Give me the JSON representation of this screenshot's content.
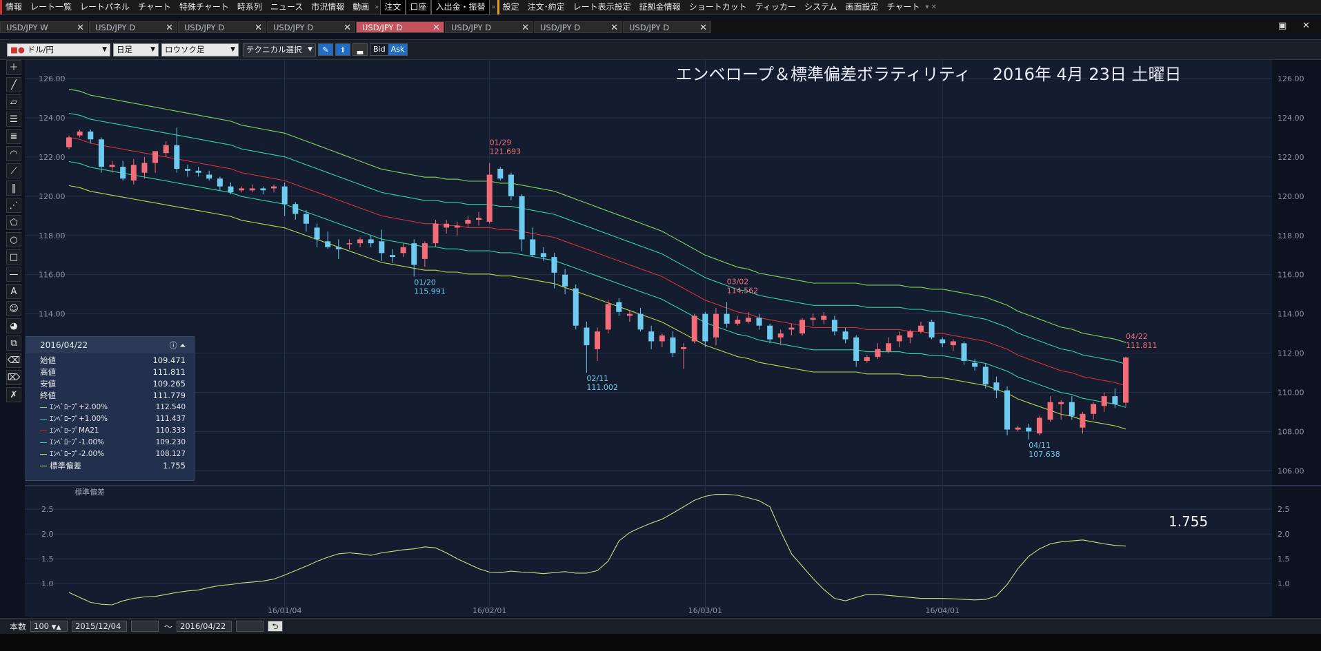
{
  "menu": [
    "情報",
    "レート一覧",
    "レートパネル",
    "チャート",
    "特殊チャート",
    "時系列",
    "ニュース",
    "市況情報",
    "動画",
    "注文",
    "口座",
    "入出金・振替",
    "設定",
    "注文･約定",
    "レート表示設定",
    "証拠金情報",
    "ショートカット",
    "ティッカー",
    "システム",
    "画面設定",
    "チャート"
  ],
  "tabs": [
    "USD/JPY W",
    "USD/JPY D",
    "USD/JPY D",
    "USD/JPY D",
    "USD/JPY D",
    "USD/JPY D",
    "USD/JPY D",
    "USD/JPY D"
  ],
  "active_tab": 4,
  "toolbar": {
    "pair": "ドル/円",
    "period": "日足",
    "style": "ロウソク足",
    "technical": "テクニカル選択",
    "bid": "Bid",
    "ask": "Ask"
  },
  "chart_title": "エンベロープ＆標準偏差ボラティリティ　 2016年 4月 23日 土曜日",
  "colors": {
    "bg": "#141c30",
    "up": "#f26d77",
    "down": "#6dcbf0",
    "env_outer": "#7ed957",
    "env_inner": "#2bd6a4",
    "ma": "#d5302f",
    "lower_outer": "#b9d84a",
    "stddev": "#c8e07a"
  },
  "info": {
    "date": "2016/04/22",
    "rows": [
      {
        "label": "始値",
        "value": "109.471",
        "color": ""
      },
      {
        "label": "高値",
        "value": "111.811",
        "color": ""
      },
      {
        "label": "安値",
        "value": "109.265",
        "color": ""
      },
      {
        "label": "終値",
        "value": "111.779",
        "color": ""
      },
      {
        "label": "ｴﾝﾍﾞﾛｰﾌﾟ+2.00%",
        "value": "112.540",
        "color": "#7ed957"
      },
      {
        "label": "ｴﾝﾍﾞﾛｰﾌﾟ+1.00%",
        "value": "111.437",
        "color": "#2bd6a4"
      },
      {
        "label": "ｴﾝﾍﾞﾛｰﾌﾟMA21",
        "value": "110.333",
        "color": "#d5302f"
      },
      {
        "label": "ｴﾝﾍﾞﾛｰﾌﾟ-1.00%",
        "value": "109.230",
        "color": "#2bd6a4"
      },
      {
        "label": "ｴﾝﾍﾞﾛｰﾌﾟ-2.00%",
        "value": "108.127",
        "color": "#b9d84a"
      },
      {
        "label": "標準偏差",
        "value": "1.755",
        "color": "#c8e07a"
      }
    ]
  },
  "bottom": {
    "count_label": "本数",
    "count": "100",
    "from": "2015/12/04",
    "tilde": "～",
    "to": "2016/04/22"
  },
  "chart_data": {
    "type": "candlestick",
    "price_axis": {
      "ticks": [
        "106.00",
        "108.00",
        "110.00",
        "112.00",
        "114.00",
        "116.00",
        "118.00",
        "120.00",
        "122.00",
        "124.00",
        "126.00"
      ],
      "ylim": [
        105.8,
        126.6
      ]
    },
    "x_labels": [
      {
        "i": 20,
        "label": "16/01/04"
      },
      {
        "i": 39,
        "label": "16/02/01"
      },
      {
        "i": 59,
        "label": "16/03/01"
      },
      {
        "i": 81,
        "label": "16/04/01"
      }
    ],
    "candles": [
      [
        122.5,
        123.1,
        122.4,
        123.0
      ],
      [
        123.1,
        123.4,
        123.0,
        123.3
      ],
      [
        123.3,
        123.4,
        122.7,
        122.9
      ],
      [
        122.9,
        123.0,
        121.2,
        121.5
      ],
      [
        121.5,
        121.8,
        121.2,
        121.6
      ],
      [
        121.5,
        121.8,
        120.8,
        120.9
      ],
      [
        120.8,
        121.9,
        120.6,
        121.6
      ],
      [
        121.2,
        122.0,
        120.9,
        121.7
      ],
      [
        121.7,
        122.3,
        121.2,
        122.3
      ],
      [
        122.2,
        122.8,
        122.0,
        122.6
      ],
      [
        122.6,
        123.5,
        121.2,
        121.4
      ],
      [
        121.4,
        121.6,
        121.0,
        121.3
      ],
      [
        121.3,
        121.5,
        121.0,
        121.2
      ],
      [
        121.1,
        121.3,
        120.8,
        120.9
      ],
      [
        120.9,
        121.0,
        120.3,
        120.5
      ],
      [
        120.5,
        120.7,
        120.1,
        120.2
      ],
      [
        120.3,
        120.5,
        120.2,
        120.4
      ],
      [
        120.3,
        120.6,
        120.2,
        120.4
      ],
      [
        120.4,
        120.5,
        120.1,
        120.3
      ],
      [
        120.4,
        120.6,
        120.2,
        120.5
      ],
      [
        120.5,
        120.7,
        119.0,
        119.6
      ],
      [
        119.6,
        119.7,
        118.8,
        119.1
      ],
      [
        119.1,
        119.3,
        118.2,
        118.6
      ],
      [
        118.4,
        118.6,
        117.4,
        117.8
      ],
      [
        117.7,
        118.2,
        117.3,
        117.4
      ],
      [
        117.4,
        117.8,
        116.8,
        117.3
      ],
      [
        117.6,
        117.8,
        117.3,
        117.6
      ],
      [
        117.6,
        117.9,
        117.4,
        117.8
      ],
      [
        117.8,
        118.0,
        117.4,
        117.6
      ],
      [
        117.7,
        118.3,
        116.7,
        117.1
      ],
      [
        117.0,
        117.3,
        116.6,
        116.9
      ],
      [
        117.1,
        117.6,
        116.9,
        117.4
      ],
      [
        117.6,
        117.8,
        115.9,
        116.5
      ],
      [
        116.8,
        117.7,
        116.4,
        117.6
      ],
      [
        117.6,
        118.8,
        117.4,
        118.6
      ],
      [
        118.4,
        118.8,
        118.1,
        118.6
      ],
      [
        118.4,
        118.7,
        118.0,
        118.5
      ],
      [
        118.6,
        119.0,
        118.4,
        118.8
      ],
      [
        118.8,
        119.2,
        118.5,
        118.9
      ],
      [
        118.7,
        121.7,
        118.6,
        121.1
      ],
      [
        121.4,
        121.5,
        120.8,
        120.9
      ],
      [
        121.1,
        121.2,
        119.8,
        120.0
      ],
      [
        120.0,
        120.1,
        117.2,
        117.8
      ],
      [
        117.8,
        118.4,
        116.9,
        117.0
      ],
      [
        117.1,
        117.4,
        116.7,
        116.9
      ],
      [
        116.9,
        117.1,
        115.3,
        116.1
      ],
      [
        116.0,
        116.3,
        115.0,
        115.4
      ],
      [
        115.3,
        115.5,
        113.2,
        113.4
      ],
      [
        113.3,
        113.6,
        111.0,
        112.4
      ],
      [
        112.2,
        113.3,
        111.6,
        113.1
      ],
      [
        113.2,
        114.7,
        113.0,
        114.5
      ],
      [
        114.6,
        114.8,
        113.9,
        114.1
      ],
      [
        113.9,
        114.2,
        113.6,
        114.0
      ],
      [
        114.0,
        114.3,
        113.1,
        113.2
      ],
      [
        113.1,
        113.4,
        112.2,
        112.6
      ],
      [
        112.6,
        113.0,
        112.3,
        112.9
      ],
      [
        112.8,
        113.1,
        111.8,
        112.0
      ],
      [
        112.2,
        112.5,
        111.2,
        112.3
      ],
      [
        112.6,
        114.0,
        112.5,
        113.9
      ],
      [
        114.0,
        114.1,
        112.3,
        112.6
      ],
      [
        112.8,
        114.3,
        112.4,
        114.0
      ],
      [
        114.0,
        114.6,
        113.3,
        113.5
      ],
      [
        113.5,
        113.9,
        113.4,
        113.7
      ],
      [
        113.6,
        114.1,
        113.5,
        113.8
      ],
      [
        113.8,
        114.0,
        113.2,
        113.4
      ],
      [
        113.4,
        113.5,
        112.5,
        112.7
      ],
      [
        112.8,
        113.2,
        112.4,
        113.0
      ],
      [
        113.2,
        113.5,
        112.9,
        113.3
      ],
      [
        113.0,
        113.8,
        112.9,
        113.7
      ],
      [
        113.7,
        114.0,
        113.4,
        113.8
      ],
      [
        113.7,
        114.1,
        113.5,
        113.9
      ],
      [
        113.7,
        113.9,
        112.9,
        113.1
      ],
      [
        113.1,
        113.3,
        112.5,
        112.7
      ],
      [
        112.8,
        112.9,
        111.3,
        111.6
      ],
      [
        111.6,
        111.9,
        111.5,
        111.8
      ],
      [
        111.8,
        112.5,
        111.7,
        112.2
      ],
      [
        112.1,
        112.8,
        112.0,
        112.5
      ],
      [
        112.6,
        113.1,
        112.3,
        112.9
      ],
      [
        112.8,
        113.2,
        112.5,
        113.1
      ],
      [
        113.1,
        113.6,
        113.0,
        113.4
      ],
      [
        113.6,
        113.7,
        112.7,
        112.8
      ],
      [
        112.7,
        112.8,
        112.3,
        112.5
      ],
      [
        112.4,
        112.7,
        112.1,
        112.6
      ],
      [
        112.5,
        112.6,
        111.4,
        111.6
      ],
      [
        111.5,
        111.7,
        111.1,
        111.3
      ],
      [
        111.3,
        111.5,
        110.2,
        110.4
      ],
      [
        110.5,
        110.8,
        109.7,
        110.1
      ],
      [
        110.1,
        110.3,
        107.8,
        108.1
      ],
      [
        108.1,
        108.3,
        108.0,
        108.2
      ],
      [
        108.2,
        108.4,
        107.6,
        108.0
      ],
      [
        107.9,
        108.8,
        107.8,
        108.7
      ],
      [
        108.6,
        109.8,
        108.5,
        109.5
      ],
      [
        109.4,
        109.6,
        108.6,
        109.5
      ],
      [
        109.5,
        109.8,
        108.6,
        108.8
      ],
      [
        108.2,
        109.0,
        107.9,
        108.9
      ],
      [
        108.9,
        109.5,
        108.6,
        109.4
      ],
      [
        109.3,
        110.0,
        109.0,
        109.8
      ],
      [
        109.8,
        110.2,
        109.2,
        109.4
      ],
      [
        109.471,
        111.811,
        109.265,
        111.779
      ]
    ],
    "envelope_ma21": [
      123.0,
      122.9,
      122.7,
      122.6,
      122.5,
      122.4,
      122.3,
      122.2,
      122.1,
      122.0,
      121.9,
      121.8,
      121.7,
      121.6,
      121.5,
      121.4,
      121.2,
      121.1,
      121.0,
      120.9,
      120.8,
      120.6,
      120.4,
      120.2,
      120.0,
      119.8,
      119.6,
      119.4,
      119.2,
      119.0,
      118.9,
      118.8,
      118.7,
      118.6,
      118.6,
      118.5,
      118.5,
      118.4,
      118.4,
      118.4,
      118.3,
      118.3,
      118.2,
      118.1,
      118.0,
      117.9,
      117.7,
      117.5,
      117.3,
      117.1,
      116.9,
      116.7,
      116.5,
      116.3,
      116.1,
      115.9,
      115.6,
      115.3,
      115.0,
      114.7,
      114.5,
      114.3,
      114.1,
      114.0,
      113.8,
      113.7,
      113.6,
      113.5,
      113.4,
      113.3,
      113.3,
      113.3,
      113.3,
      113.3,
      113.2,
      113.2,
      113.2,
      113.2,
      113.1,
      113.1,
      113.0,
      113.0,
      112.9,
      112.8,
      112.7,
      112.6,
      112.4,
      112.2,
      111.9,
      111.7,
      111.5,
      111.3,
      111.1,
      111.0,
      110.8,
      110.7,
      110.6,
      110.5,
      110.333
    ],
    "envelope_pct": [
      2.0,
      1.0,
      -1.0,
      -2.0
    ],
    "stddev_axis": {
      "ticks": [
        "1.0",
        "1.5",
        "2.0",
        "2.5"
      ],
      "ylim": [
        0.5,
        2.85
      ]
    },
    "stddev": [
      0.82,
      0.72,
      0.62,
      0.58,
      0.57,
      0.65,
      0.7,
      0.73,
      0.74,
      0.78,
      0.82,
      0.85,
      0.87,
      0.92,
      0.96,
      0.98,
      1.01,
      1.03,
      1.05,
      1.09,
      1.17,
      1.26,
      1.35,
      1.45,
      1.53,
      1.6,
      1.62,
      1.6,
      1.57,
      1.62,
      1.65,
      1.68,
      1.7,
      1.74,
      1.72,
      1.62,
      1.5,
      1.4,
      1.3,
      1.23,
      1.22,
      1.25,
      1.23,
      1.22,
      1.2,
      1.22,
      1.24,
      1.21,
      1.21,
      1.26,
      1.45,
      1.86,
      2.03,
      2.13,
      2.22,
      2.3,
      2.42,
      2.55,
      2.68,
      2.76,
      2.8,
      2.8,
      2.78,
      2.73,
      2.67,
      2.55,
      2.05,
      1.6,
      1.35,
      1.1,
      0.88,
      0.7,
      0.65,
      0.72,
      0.78,
      0.78,
      0.76,
      0.74,
      0.72,
      0.7,
      0.7,
      0.7,
      0.69,
      0.68,
      0.67,
      0.68,
      0.75,
      0.98,
      1.3,
      1.55,
      1.7,
      1.8,
      1.84,
      1.86,
      1.88,
      1.84,
      1.8,
      1.77,
      1.755
    ],
    "annotations": [
      {
        "i": 39,
        "date": "01/29",
        "value": "121.693",
        "kind": "high"
      },
      {
        "i": 32,
        "date": "01/20",
        "value": "115.991",
        "kind": "low"
      },
      {
        "i": 48,
        "date": "02/11",
        "value": "111.002",
        "kind": "low"
      },
      {
        "i": 61,
        "date": "03/02",
        "value": "114.562",
        "kind": "high"
      },
      {
        "i": 89,
        "date": "04/11",
        "value": "107.638",
        "kind": "low"
      },
      {
        "i": 98,
        "date": "04/22",
        "value": "111.811",
        "kind": "high"
      }
    ],
    "stddev_label": "標準偏差",
    "stddev_last": "1.755"
  }
}
